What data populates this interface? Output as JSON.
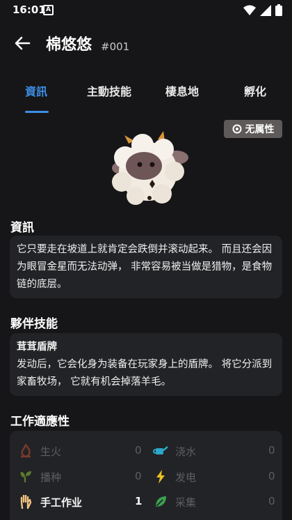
{
  "status": {
    "time": "16:01",
    "a_badge": "A"
  },
  "header": {
    "title": "棉悠悠",
    "number": "#001"
  },
  "tabs": [
    "資訊",
    "主動技能",
    "棲息地",
    "孵化"
  ],
  "element_badge": "无属性",
  "info": {
    "heading": "資訊",
    "text": "它只要走在坡道上就肯定会跌倒并滚动起来。 而且还会因为眼冒金星而无法动弹， 非常容易被当做是猎物，是食物链的底层。"
  },
  "partner_skill": {
    "heading": "夥伴技能",
    "name": "茸茸盾牌",
    "text": "发动后，它会化身为装备在玩家身上的盾牌。 将它分派到家畜牧场， 它就有机会掉落羊毛。"
  },
  "work": {
    "heading": "工作適應性",
    "items": [
      {
        "label": "生火",
        "value": "0",
        "icon": "fire-icon",
        "color": "#7a3a2c"
      },
      {
        "label": "浇水",
        "value": "0",
        "icon": "watering-can-icon",
        "color": "#2aa7c9"
      },
      {
        "label": "播种",
        "value": "0",
        "icon": "sprout-icon",
        "color": "#5a7a2c"
      },
      {
        "label": "发电",
        "value": "0",
        "icon": "lightning-icon",
        "color": "#e8c020"
      },
      {
        "label": "手工作业",
        "value": "1",
        "icon": "hand-icon",
        "color": "#f0c080"
      },
      {
        "label": "采集",
        "value": "0",
        "icon": "leaf-icon",
        "color": "#3aa050"
      }
    ]
  }
}
